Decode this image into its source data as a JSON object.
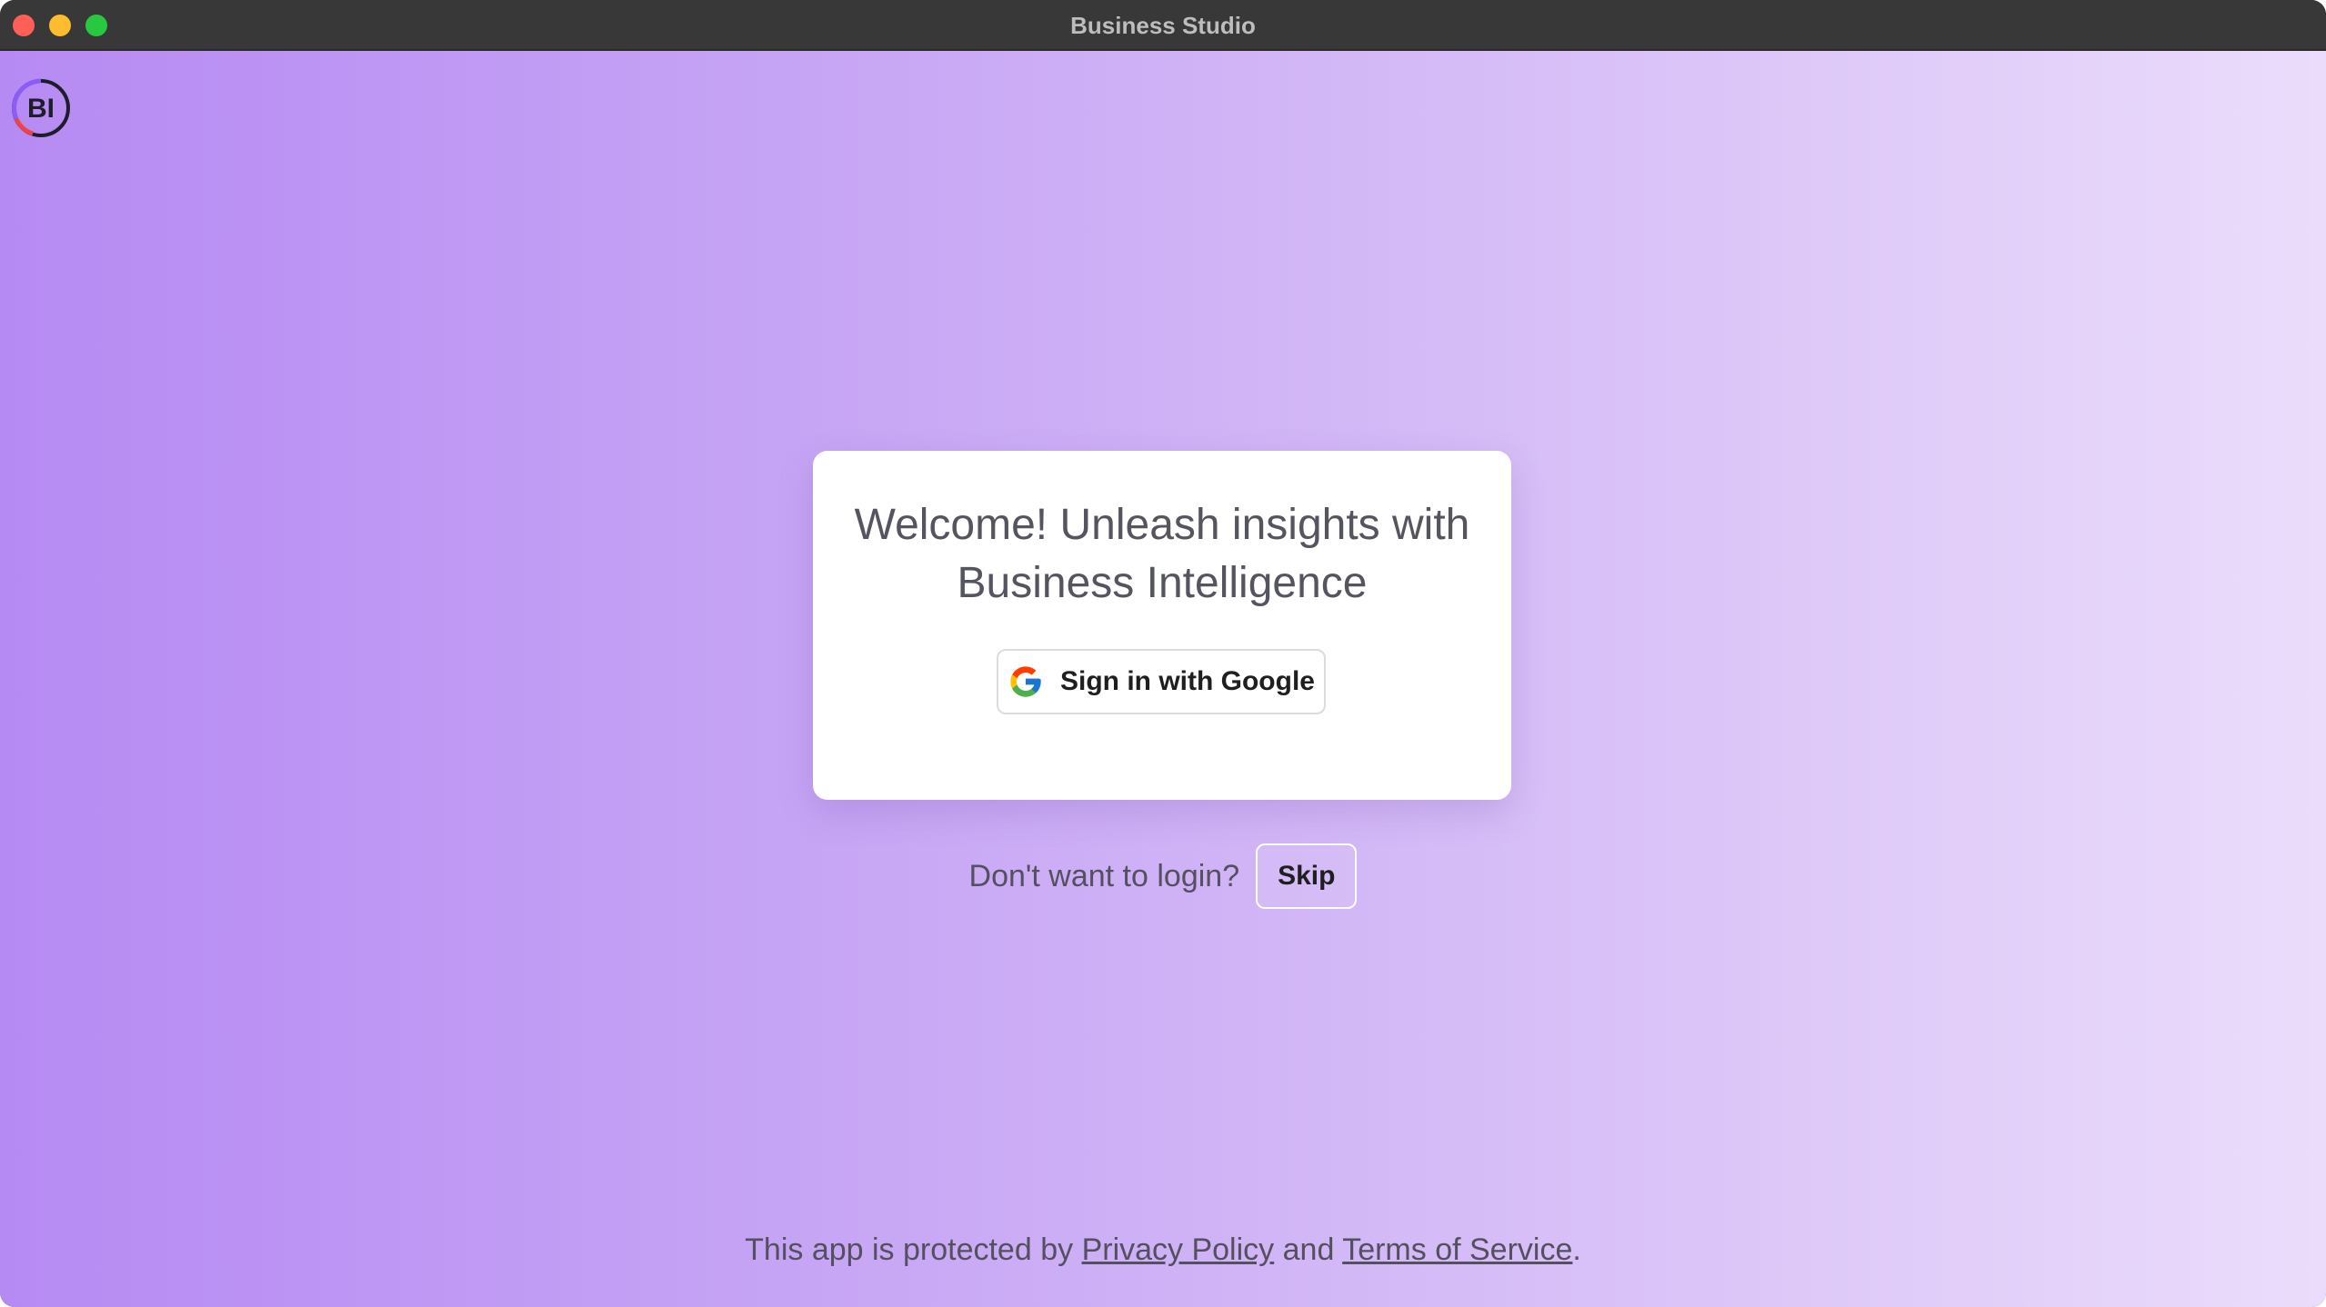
{
  "window": {
    "title": "Business Studio"
  },
  "logo": {
    "text": "BI",
    "icon": "bi-logo-icon"
  },
  "card": {
    "headline": "Welcome! Unleash insights with Business Intelligence",
    "google_button_label": "Sign in with Google",
    "google_icon": "google-g-icon"
  },
  "skip": {
    "prompt": "Don't want to login?",
    "button_label": "Skip"
  },
  "footer": {
    "prefix": "This app is protected by",
    "privacy_link": "Privacy Policy",
    "conjunction": "and",
    "terms_link": "Terms of Service",
    "suffix": "."
  },
  "colors": {
    "gradient_start": "#b68af3",
    "gradient_end": "#ebdcfb",
    "close": "#ff5f57",
    "minimize": "#febc2e",
    "maximize": "#28c840"
  }
}
